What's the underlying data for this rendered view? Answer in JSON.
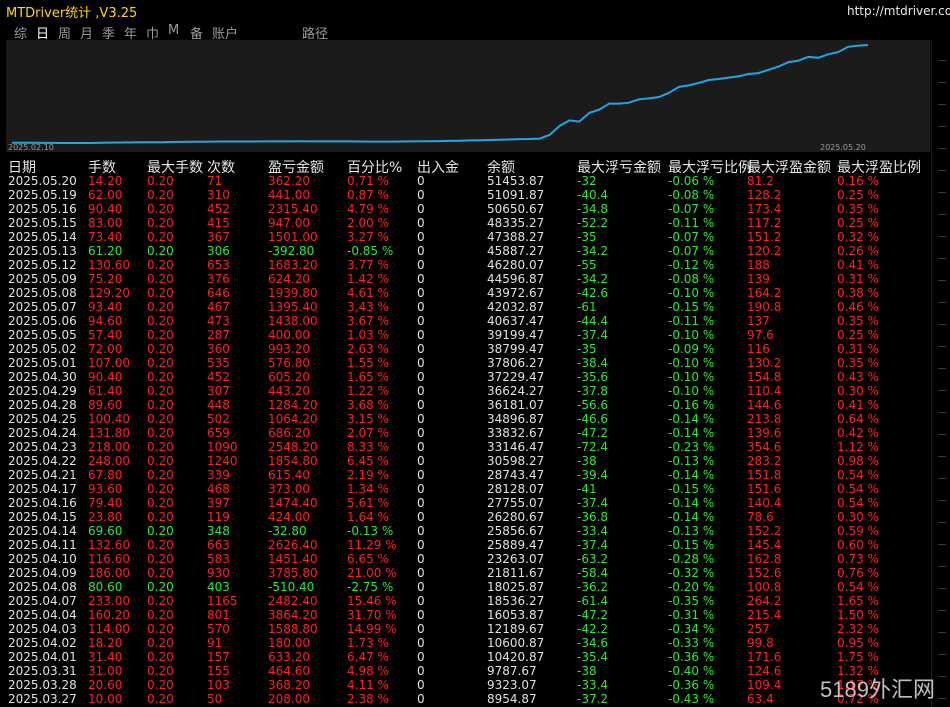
{
  "app": {
    "title": "MTDriver统计 ,V3.25",
    "url": "http://mtdriver.com"
  },
  "tabs": [
    "综",
    "日",
    "周",
    "月",
    "季",
    "年",
    "巾",
    "M",
    "备",
    "账户",
    "路径"
  ],
  "active_tab": 1,
  "chart": {
    "start_label": "2025.02.10",
    "end_label": "2025.05.20",
    "line_color": "#1ea7e8",
    "values": [
      8800,
      8780,
      8760,
      8740,
      8720,
      8700,
      8690,
      8680,
      8680,
      8750,
      8850,
      8900,
      8950,
      9000,
      9050,
      9050,
      9100,
      9150,
      9200,
      9250,
      9300,
      9320,
      9330,
      9350,
      9350,
      9380,
      9390,
      9400,
      9400,
      9420,
      9380,
      9400,
      9400,
      9380,
      9360,
      9340,
      9300,
      9280,
      9300,
      9350,
      9380,
      9420,
      9450,
      9500,
      9600,
      9700,
      9800,
      9900,
      10000,
      10100,
      10200,
      10400,
      10420,
      10600,
      12189,
      16053,
      18536,
      18025,
      21811,
      23263,
      25889,
      25856,
      26280,
      27755,
      28128,
      28743,
      30598,
      33146,
      33832,
      34896,
      36181,
      36624,
      37229,
      37806,
      38799,
      39199,
      40637,
      42032,
      43972,
      44596,
      46280,
      45887,
      47388,
      48335,
      50650,
      51091,
      51453
    ]
  },
  "headers": [
    "日期",
    "手数",
    "最大手数",
    "次数",
    "盈亏金额",
    "百分比%",
    "出入金",
    "余额",
    "最大浮亏金额",
    "最大浮亏比例",
    "最大浮盈金额",
    "最大浮盈比例"
  ],
  "rows": [
    [
      "2025.05.20",
      "14.20",
      "0.20",
      "71",
      "362.20",
      "0.71 %",
      "0",
      "51453.87",
      "-32",
      "-0.06 %",
      "81.2",
      "0.16 %",
      "r"
    ],
    [
      "2025.05.19",
      "62.00",
      "0.20",
      "310",
      "441.00",
      "0.87 %",
      "0",
      "51091.87",
      "-40.4",
      "-0.08 %",
      "128.2",
      "0.25 %",
      "r"
    ],
    [
      "2025.05.16",
      "90.40",
      "0.20",
      "452",
      "2315.40",
      "4.79 %",
      "0",
      "50650.67",
      "-34.8",
      "-0.07 %",
      "173.4",
      "0.35 %",
      "r"
    ],
    [
      "2025.05.15",
      "83.00",
      "0.20",
      "415",
      "947.00",
      "2.00 %",
      "0",
      "48335.27",
      "-52.2",
      "-0.11 %",
      "117.2",
      "0.25 %",
      "r"
    ],
    [
      "2025.05.14",
      "73.40",
      "0.20",
      "367",
      "1501.00",
      "3.27 %",
      "0",
      "47388.27",
      "-35",
      "-0.07 %",
      "151.2",
      "0.32 %",
      "r"
    ],
    [
      "2025.05.13",
      "61.20",
      "0.20",
      "306",
      "-392.80",
      "-0.85 %",
      "0",
      "45887.27",
      "-34.2",
      "-0.07 %",
      "120.2",
      "0.26 %",
      "g"
    ],
    [
      "2025.05.12",
      "130.60",
      "0.20",
      "653",
      "1683.20",
      "3.77 %",
      "0",
      "46280.07",
      "-55",
      "-0.12 %",
      "188",
      "0.41 %",
      "r"
    ],
    [
      "2025.05.09",
      "75.20",
      "0.20",
      "376",
      "624.20",
      "1.42 %",
      "0",
      "44596.87",
      "-34.2",
      "-0.08 %",
      "139",
      "0.31 %",
      "r"
    ],
    [
      "2025.05.08",
      "129.20",
      "0.20",
      "646",
      "1939.80",
      "4.61 %",
      "0",
      "43972.67",
      "-42.6",
      "-0.10 %",
      "164.2",
      "0.38 %",
      "r"
    ],
    [
      "2025.05.07",
      "93.40",
      "0.20",
      "467",
      "1395.40",
      "3.43 %",
      "0",
      "42032.87",
      "-61",
      "-0.15 %",
      "190.8",
      "0.46 %",
      "r"
    ],
    [
      "2025.05.06",
      "94.60",
      "0.20",
      "473",
      "1438.00",
      "3.67 %",
      "0",
      "40637.47",
      "-44.4",
      "-0.11 %",
      "137",
      "0.35 %",
      "r"
    ],
    [
      "2025.05.05",
      "57.40",
      "0.20",
      "287",
      "400.00",
      "1.03 %",
      "0",
      "39199.47",
      "-37.4",
      "-0.10 %",
      "97.6",
      "0.25 %",
      "r"
    ],
    [
      "2025.05.02",
      "72.00",
      "0.20",
      "360",
      "993.20",
      "2.63 %",
      "0",
      "38799.47",
      "-35",
      "-0.09 %",
      "116",
      "0.31 %",
      "r"
    ],
    [
      "2025.05.01",
      "107.00",
      "0.20",
      "535",
      "576.80",
      "1.55 %",
      "0",
      "37806.27",
      "-38.4",
      "-0.10 %",
      "130.2",
      "0.35 %",
      "r"
    ],
    [
      "2025.04.30",
      "90.40",
      "0.20",
      "452",
      "605.20",
      "1.65 %",
      "0",
      "37229.47",
      "-35.6",
      "-0.10 %",
      "154.8",
      "0.43 %",
      "r"
    ],
    [
      "2025.04.29",
      "61.40",
      "0.20",
      "307",
      "443.20",
      "1.22 %",
      "0",
      "36624.27",
      "-37.8",
      "-0.10 %",
      "110.4",
      "0.30 %",
      "r"
    ],
    [
      "2025.04.28",
      "89.60",
      "0.20",
      "448",
      "1284.20",
      "3.68 %",
      "0",
      "36181.07",
      "-56.6",
      "-0.16 %",
      "144.6",
      "0.41 %",
      "r"
    ],
    [
      "2025.04.25",
      "100.40",
      "0.20",
      "502",
      "1064.20",
      "3.15 %",
      "0",
      "34896.87",
      "-46.6",
      "-0.14 %",
      "213.8",
      "0.64 %",
      "r"
    ],
    [
      "2025.04.24",
      "131.80",
      "0.20",
      "659",
      "686.20",
      "2.07 %",
      "0",
      "33832.67",
      "-47.2",
      "-0.14 %",
      "139.6",
      "0.42 %",
      "r"
    ],
    [
      "2025.04.23",
      "218.00",
      "0.20",
      "1090",
      "2548.20",
      "8.33 %",
      "0",
      "33146.47",
      "-72.4",
      "-0.23 %",
      "354.6",
      "1.12 %",
      "r"
    ],
    [
      "2025.04.22",
      "248.00",
      "0.20",
      "1240",
      "1854.80",
      "6.45 %",
      "0",
      "30598.27",
      "-38",
      "-0.13 %",
      "283.2",
      "0.98 %",
      "r"
    ],
    [
      "2025.04.21",
      "67.80",
      "0.20",
      "339",
      "615.40",
      "2.19 %",
      "0",
      "28743.47",
      "-39.4",
      "-0.14 %",
      "151.8",
      "0.54 %",
      "r"
    ],
    [
      "2025.04.17",
      "93.60",
      "0.20",
      "468",
      "373.00",
      "1.34 %",
      "0",
      "28128.07",
      "-41",
      "-0.15 %",
      "151.6",
      "0.54 %",
      "r"
    ],
    [
      "2025.04.16",
      "79.40",
      "0.20",
      "397",
      "1474.40",
      "5.61 %",
      "0",
      "27755.07",
      "-37.4",
      "-0.14 %",
      "140.4",
      "0.54 %",
      "r"
    ],
    [
      "2025.04.15",
      "23.80",
      "0.20",
      "119",
      "424.00",
      "1.64 %",
      "0",
      "26280.67",
      "-36.8",
      "-0.14 %",
      "78.6",
      "0.30 %",
      "r"
    ],
    [
      "2025.04.14",
      "69.60",
      "0.20",
      "348",
      "-32.80",
      "-0.13 %",
      "0",
      "25856.67",
      "-33.4",
      "-0.13 %",
      "152.2",
      "0.59 %",
      "g"
    ],
    [
      "2025.04.11",
      "132.60",
      "0.20",
      "663",
      "2626.40",
      "11.29 %",
      "0",
      "25889.47",
      "-37.4",
      "-0.15 %",
      "145.4",
      "0.60 %",
      "r"
    ],
    [
      "2025.04.10",
      "116.60",
      "0.20",
      "583",
      "1451.40",
      "6.65 %",
      "0",
      "23263.07",
      "-63.2",
      "-0.28 %",
      "162.8",
      "0.73 %",
      "r"
    ],
    [
      "2025.04.09",
      "186.00",
      "0.20",
      "930",
      "3785.80",
      "21.00 %",
      "0",
      "21811.67",
      "-58.4",
      "-0.32 %",
      "152.6",
      "0.76 %",
      "r"
    ],
    [
      "2025.04.08",
      "80.60",
      "0.20",
      "403",
      "-510.40",
      "-2.75 %",
      "0",
      "18025.87",
      "-36.2",
      "-0.20 %",
      "100.8",
      "0.54 %",
      "g"
    ],
    [
      "2025.04.07",
      "233.00",
      "0.20",
      "1165",
      "2482.40",
      "15.46 %",
      "0",
      "18536.27",
      "-61.4",
      "-0.35 %",
      "264.2",
      "1.65 %",
      "r"
    ],
    [
      "2025.04.04",
      "160.20",
      "0.20",
      "801",
      "3864.20",
      "31.70 %",
      "0",
      "16053.87",
      "-47.2",
      "-0.31 %",
      "215.4",
      "1.50 %",
      "r"
    ],
    [
      "2025.04.03",
      "114.00",
      "0.20",
      "570",
      "1588.80",
      "14.99 %",
      "0",
      "12189.67",
      "-42.2",
      "-0.34 %",
      "257",
      "2.32 %",
      "r"
    ],
    [
      "2025.04.02",
      "18.20",
      "0.20",
      "91",
      "180.00",
      "1.73 %",
      "0",
      "10600.87",
      "-34.6",
      "-0.33 %",
      "99.8",
      "0.95 %",
      "r"
    ],
    [
      "2025.04.01",
      "31.40",
      "0.20",
      "157",
      "633.20",
      "6.47 %",
      "0",
      "10420.87",
      "-35.4",
      "-0.36 %",
      "171.6",
      "1.75 %",
      "r"
    ],
    [
      "2025.03.31",
      "31.00",
      "0.20",
      "155",
      "464.60",
      "4.98 %",
      "0",
      "9787.67",
      "-38",
      "-0.40 %",
      "124.6",
      "1.32 %",
      "r"
    ],
    [
      "2025.03.28",
      "20.60",
      "0.20",
      "103",
      "368.20",
      "4.11 %",
      "0",
      "9323.07",
      "-33.4",
      "-0.36 %",
      "109.4",
      "1.17 %",
      "r"
    ],
    [
      "2025.03.27",
      "10.00",
      "0.20",
      "50",
      "208.00",
      "2.38 %",
      "0",
      "8954.87",
      "-37.2",
      "-0.43 %",
      "63.4",
      "0.72 %",
      "r"
    ]
  ],
  "watermark": "5189外汇网",
  "colors": {
    "positive": "#ff2020",
    "negative": "#2ee82e",
    "title": "#ffd400"
  }
}
